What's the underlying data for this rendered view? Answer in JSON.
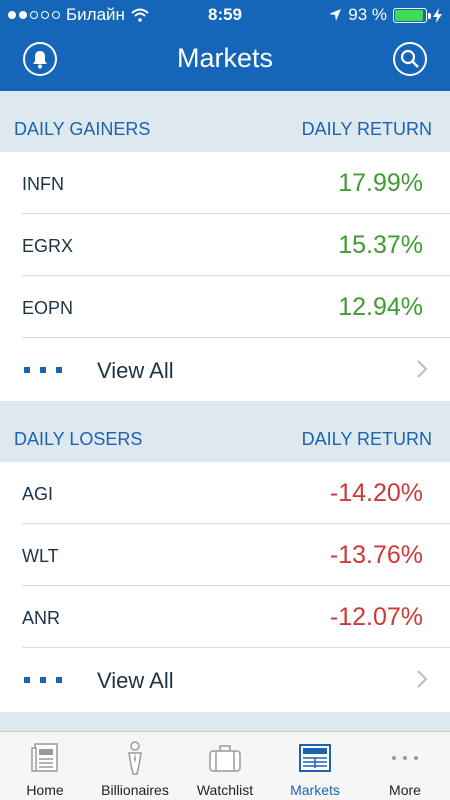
{
  "status": {
    "carrier": "Билайн",
    "time": "8:59",
    "battery": "93 %"
  },
  "nav": {
    "title": "Markets"
  },
  "gainers": {
    "title": "DAILY GAINERS",
    "col": "DAILY RETURN",
    "rows": [
      {
        "symbol": "INFN",
        "value": "17.99%"
      },
      {
        "symbol": "EGRX",
        "value": "15.37%"
      },
      {
        "symbol": "EOPN",
        "value": "12.94%"
      }
    ],
    "view_all": "View All"
  },
  "losers": {
    "title": "DAILY LOSERS",
    "col": "DAILY RETURN",
    "rows": [
      {
        "symbol": "AGI",
        "value": "-14.20%"
      },
      {
        "symbol": "WLT",
        "value": "-13.76%"
      },
      {
        "symbol": "ANR",
        "value": "-12.07%"
      }
    ],
    "view_all": "View All"
  },
  "tabs": [
    {
      "label": "Home",
      "icon": "newspaper-icon"
    },
    {
      "label": "Billionaires",
      "icon": "person-icon"
    },
    {
      "label": "Watchlist",
      "icon": "briefcase-icon"
    },
    {
      "label": "Markets",
      "icon": "markets-icon"
    },
    {
      "label": "More",
      "icon": "more-dots-icon"
    }
  ],
  "colors": {
    "header": "#1565b9",
    "accent": "#1d63b0",
    "gain": "#3f9b33",
    "loss": "#cc3a36",
    "section": "#dde8ef"
  }
}
